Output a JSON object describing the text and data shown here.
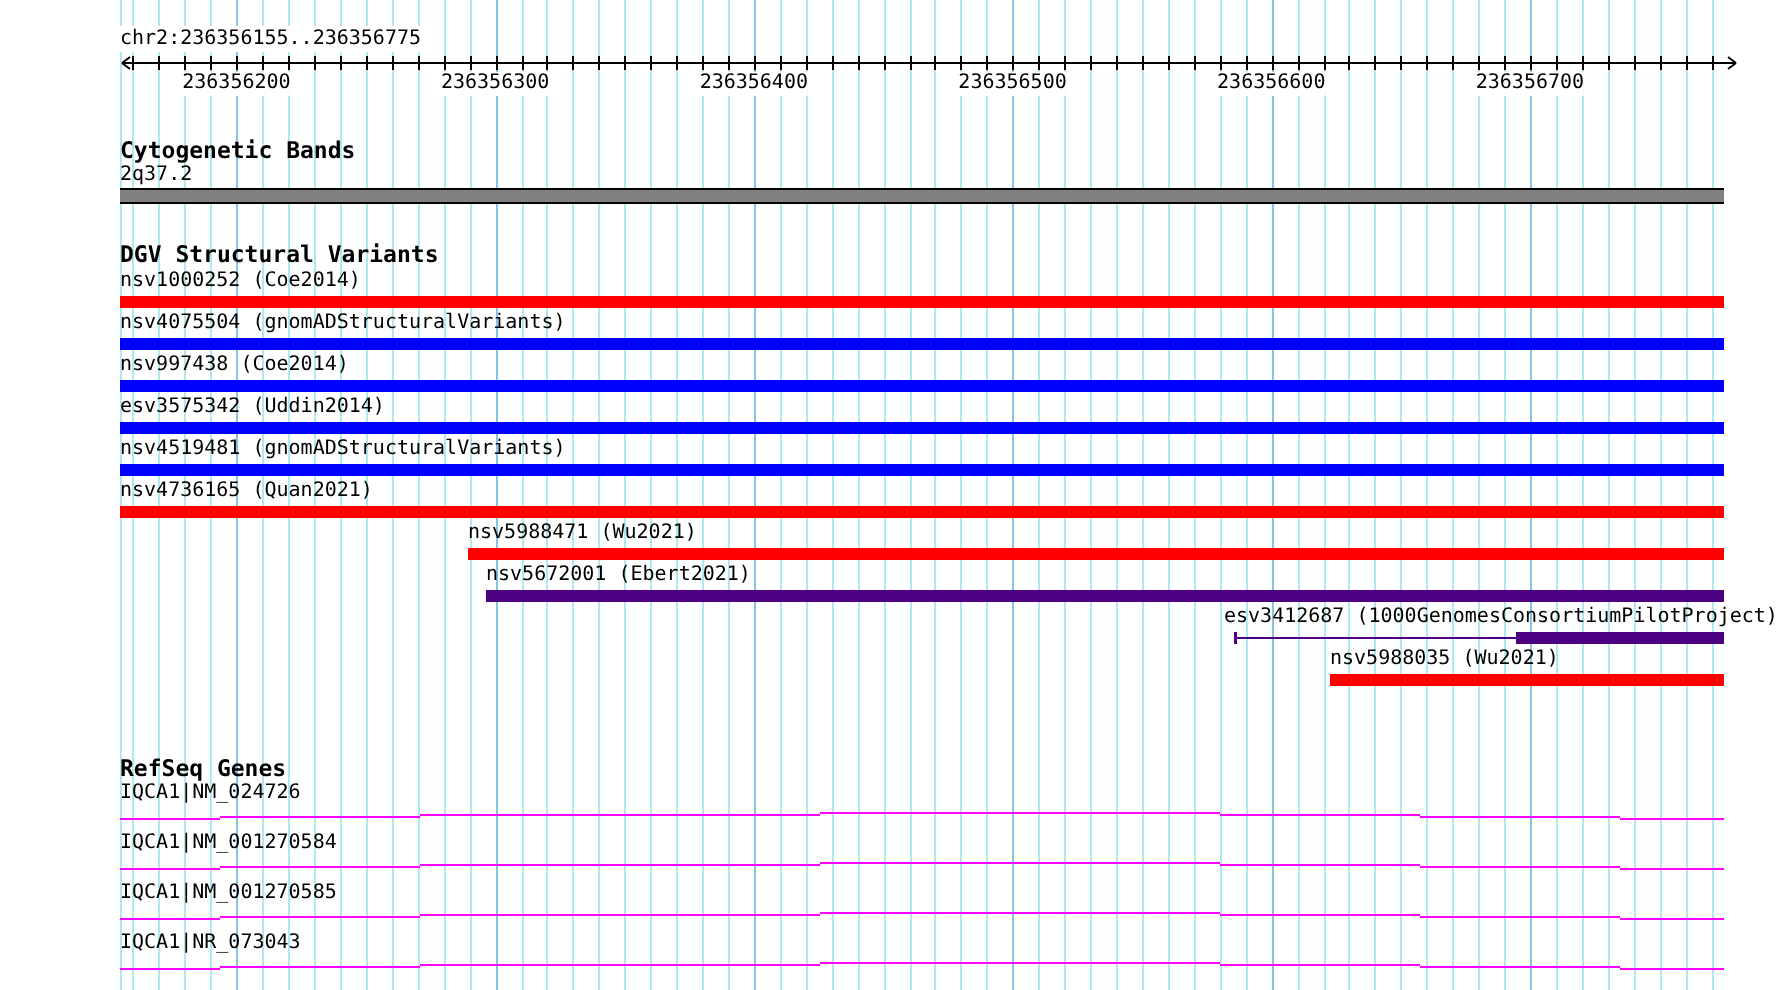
{
  "ruler": {
    "location": "chr2:236356155..236356775",
    "ticks": [
      "236356200",
      "236356300",
      "236356400",
      "236356500",
      "236356600",
      "236356700"
    ]
  },
  "cytogenetic_bands": {
    "title": "Cytogenetic Bands",
    "band": "2q37.2"
  },
  "dgv_structural_variants": {
    "title": "DGV Structural Variants",
    "features": [
      {
        "label": "nsv1000252 (Coe2014)",
        "color": "#ff0000",
        "kind": "solid"
      },
      {
        "label": "nsv4075504 (gnomADStructuralVariants)",
        "color": "#0000ff",
        "kind": "solid"
      },
      {
        "label": "nsv997438 (Coe2014)",
        "color": "#0000ff",
        "kind": "solid"
      },
      {
        "label": "esv3575342 (Uddin2014)",
        "color": "#0000ff",
        "kind": "solid"
      },
      {
        "label": "nsv4519481 (gnomADStructuralVariants)",
        "color": "#0000ff",
        "kind": "solid"
      },
      {
        "label": "nsv4736165 (Quan2021)",
        "color": "#ff0000",
        "kind": "solid"
      },
      {
        "label": "nsv5988471 (Wu2021)",
        "color": "#ff0000",
        "kind": "solid"
      },
      {
        "label": "nsv5672001 (Ebert2021)",
        "color": "#4b0082",
        "kind": "solid"
      },
      {
        "label": "esv3412687 (1000GenomesConsortiumPilotProject)",
        "color": "#4b0082",
        "kind": "split"
      },
      {
        "label": "nsv5988035 (Wu2021)",
        "color": "#ff0000",
        "kind": "solid"
      }
    ]
  },
  "refseq_genes": {
    "title": "RefSeq Genes",
    "genes": [
      {
        "label": "IQCA1|NM_024726"
      },
      {
        "label": "IQCA1|NM_001270584"
      },
      {
        "label": "IQCA1|NM_001270585"
      },
      {
        "label": "IQCA1|NR_073043"
      }
    ]
  }
}
